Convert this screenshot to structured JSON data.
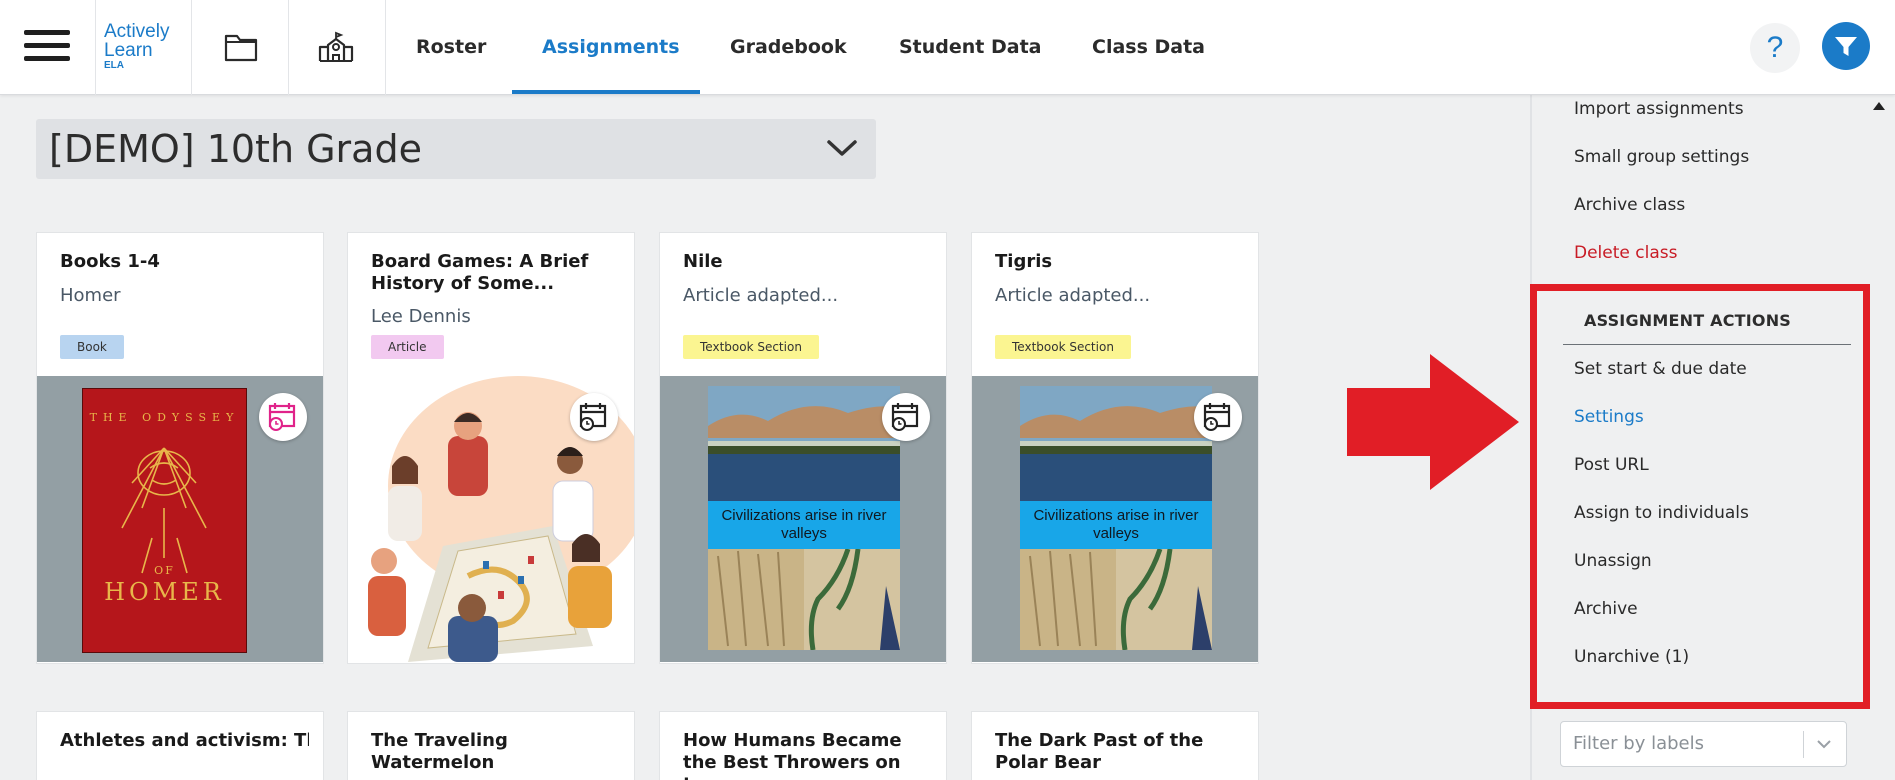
{
  "logo": {
    "line1": "Actively",
    "line2": "Learn",
    "line3": "ELA"
  },
  "nav": {
    "tabs": [
      {
        "label": "Roster"
      },
      {
        "label": "Assignments",
        "active": true
      },
      {
        "label": "Gradebook"
      },
      {
        "label": "Student Data"
      },
      {
        "label": "Class Data"
      }
    ],
    "help_label": "?"
  },
  "class_selector": {
    "value": "[DEMO] 10th Grade"
  },
  "cards": [
    {
      "title": "Books 1-4",
      "author": "Homer",
      "type": "Book",
      "cover": "odyssey-cover",
      "cover_title": "THE ODYSSEY",
      "cover_of": "OF",
      "cover_author": "HOMER",
      "schedule_icon": "calendar-clock-pink-icon"
    },
    {
      "title": "Board Games: A Brief History of Some...",
      "author": "Lee Dennis",
      "type": "Article",
      "cover": "board-game-illustration",
      "schedule_icon": "calendar-clock-icon"
    },
    {
      "title": "Nile",
      "author": "Article adapted...",
      "type": "Textbook Section",
      "cover": "river-valley-image",
      "cover_caption": "Civilizations arise in river valleys",
      "schedule_icon": "calendar-clock-icon"
    },
    {
      "title": "Tigris",
      "author": "Article adapted...",
      "type": "Textbook Section",
      "cover": "river-valley-image",
      "cover_caption": "Civilizations arise in river valleys",
      "schedule_icon": "calendar-clock-icon"
    },
    {
      "title": "Athletes and activism: The long, defiant histor..."
    },
    {
      "title": "The Traveling Watermelon"
    },
    {
      "title": "How Humans Became the Best Throwers on t..."
    },
    {
      "title": "The Dark Past of the Polar Bear"
    }
  ],
  "side_panel": {
    "class_actions": [
      {
        "label": "Import assignments"
      },
      {
        "label": "Small group settings"
      },
      {
        "label": "Archive class"
      },
      {
        "label": "Delete class",
        "style": "danger"
      }
    ],
    "assignment_actions_header": "ASSIGNMENT ACTIONS",
    "assignment_actions": [
      {
        "label": "Set start & due date"
      },
      {
        "label": "Settings",
        "style": "link"
      },
      {
        "label": "Post URL"
      },
      {
        "label": "Assign to individuals"
      },
      {
        "label": "Unassign"
      },
      {
        "label": "Archive"
      },
      {
        "label": "Unarchive (1)"
      }
    ],
    "filter_labels_placeholder": "Filter by labels"
  },
  "colors": {
    "brand_blue": "#1b7bc8",
    "danger_red": "#c81b25",
    "annotation_red": "#e11e26",
    "badge_book": "#b8d4f0",
    "badge_article": "#f2c9f0",
    "badge_textbook": "#fbf591"
  }
}
